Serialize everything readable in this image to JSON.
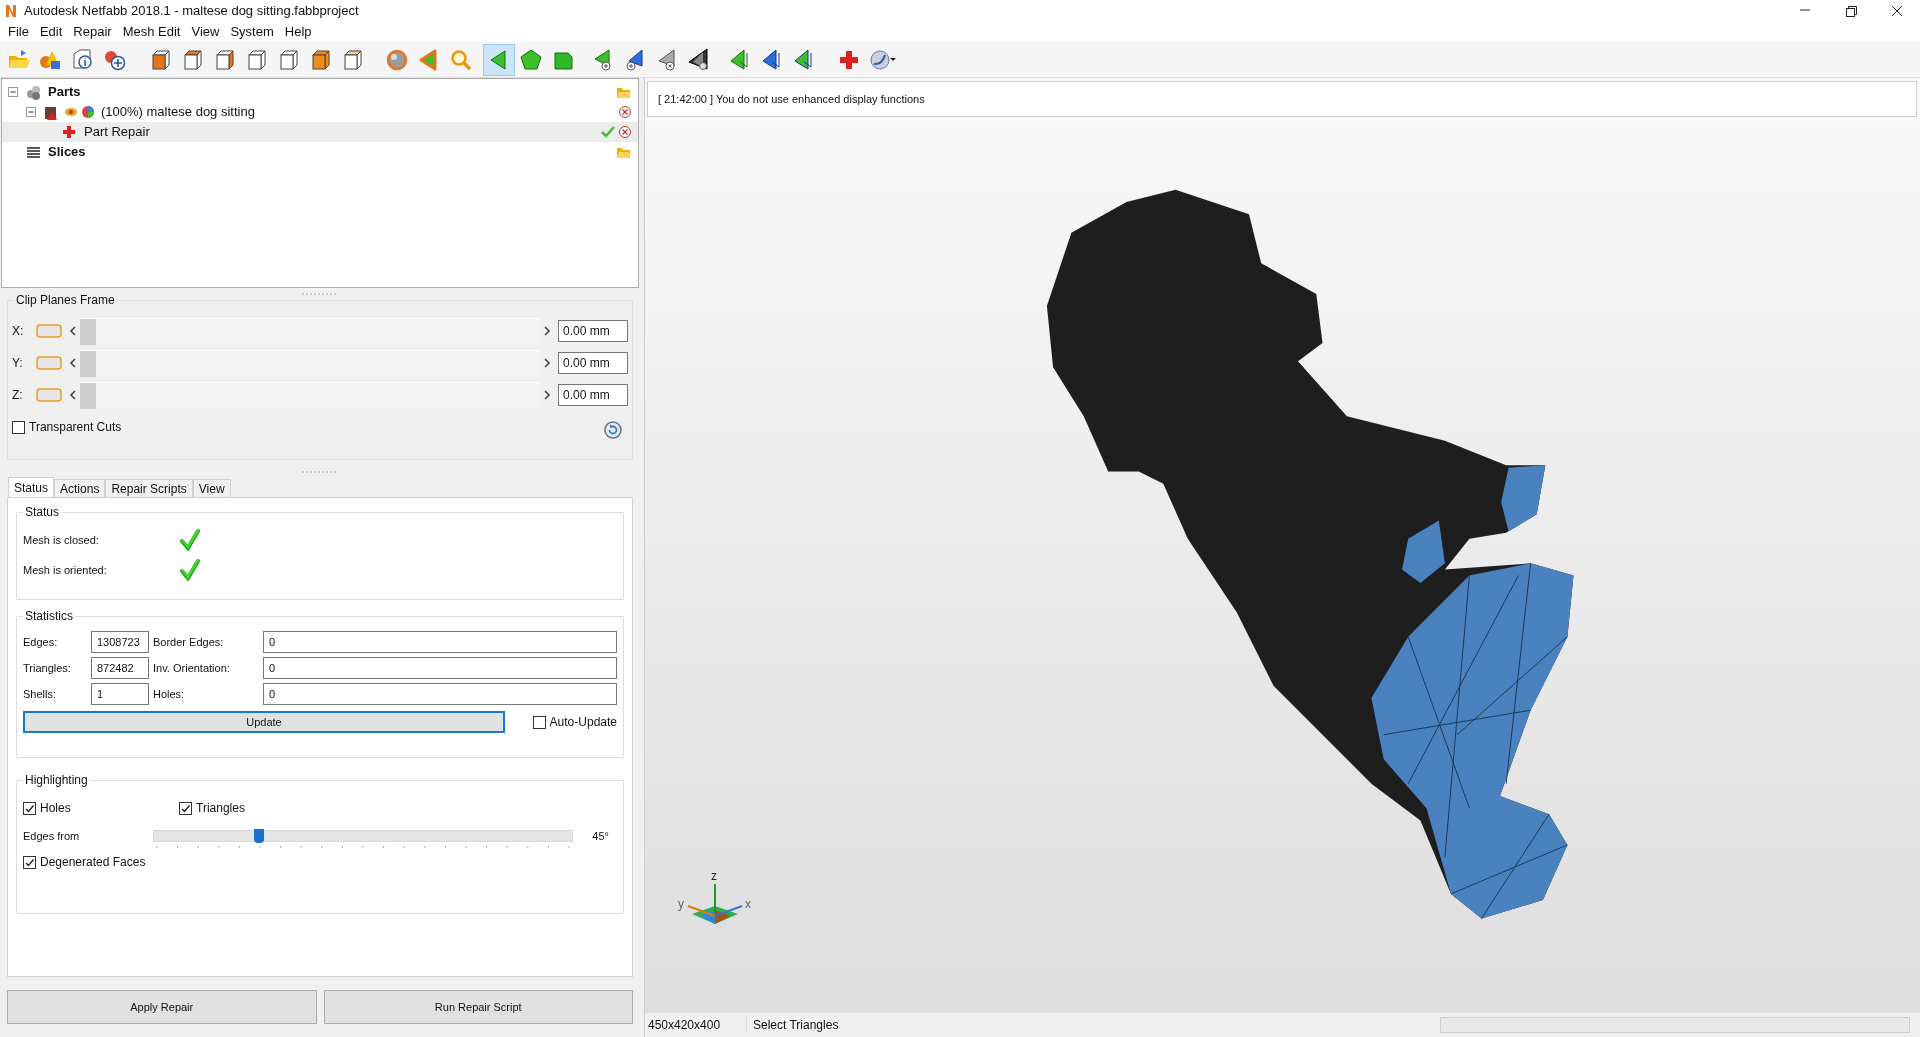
{
  "window": {
    "title": "Autodesk Netfabb 2018.1 - maltese dog sitting.fabbproject"
  },
  "menu": [
    "File",
    "Edit",
    "Repair",
    "Mesh Edit",
    "View",
    "System",
    "Help"
  ],
  "toolbar": [
    {
      "selected": false
    },
    {
      "selected": false
    },
    {
      "selected": false
    },
    {
      "selected": false
    },
    {
      "selected": false
    },
    {
      "selected": false
    },
    {
      "selected": false
    },
    {
      "selected": false
    },
    {
      "selected": false
    },
    {
      "selected": false
    },
    {
      "selected": false
    },
    {
      "selected": false
    },
    {
      "selected": false
    },
    {
      "selected": false
    },
    {
      "selected": true
    },
    {
      "selected": false
    },
    {
      "selected": false
    },
    {
      "selected": false
    },
    {
      "selected": false
    },
    {
      "selected": false
    },
    {
      "selected": false
    },
    {
      "selected": false
    },
    {
      "selected": false
    },
    {
      "selected": false
    },
    {
      "selected": false
    },
    {
      "selected": false
    }
  ],
  "tree": [
    {
      "kind": "group",
      "label": "Parts",
      "expanded": true,
      "selected": false,
      "children": [
        {
          "kind": "part",
          "label": "(100%) maltese dog sitting",
          "expanded": true,
          "selected": false,
          "children": [
            {
              "kind": "repair",
              "label": "Part Repair",
              "selected": true
            }
          ]
        }
      ]
    },
    {
      "kind": "slices",
      "label": "Slices",
      "selected": false
    }
  ],
  "clip_planes": {
    "title": "Clip Planes Frame",
    "axes": [
      {
        "label": "X:",
        "level": 0,
        "value": "0.00 mm"
      },
      {
        "label": "Y:",
        "level": 0,
        "value": "0.00 mm"
      },
      {
        "label": "Z:",
        "level": 0,
        "value": "0.00 mm"
      }
    ],
    "transparent_cuts": {
      "label": "Transparent Cuts",
      "checked": false
    }
  },
  "tabs": [
    {
      "label": "Status",
      "selected": true
    },
    {
      "label": "Actions",
      "selected": false
    },
    {
      "label": "Repair Scripts",
      "selected": false
    },
    {
      "label": "View",
      "selected": false
    }
  ],
  "status": {
    "title": "Status",
    "items": [
      {
        "label": "Mesh is closed:",
        "ok": true
      },
      {
        "label": "Mesh is oriented:",
        "ok": true
      }
    ]
  },
  "statistics": {
    "title": "Statistics",
    "rows": [
      [
        {
          "label": "Edges:",
          "value": "1308723"
        },
        {
          "label": "Border Edges:",
          "value": "0"
        }
      ],
      [
        {
          "label": "Triangles:",
          "value": "872482"
        },
        {
          "label": "Inv. Orientation:",
          "value": "0"
        }
      ],
      [
        {
          "label": "Shells:",
          "value": "1"
        },
        {
          "label": "Holes:",
          "value": "0"
        }
      ]
    ],
    "update_button": "Update",
    "auto_update": {
      "label": "Auto-Update",
      "checked": false
    }
  },
  "highlighting": {
    "title": "Highlighting",
    "holes": {
      "label": "Holes",
      "checked": true
    },
    "triangles": {
      "label": "Triangles",
      "checked": true
    },
    "edges_from": {
      "label": "Edges from",
      "level": 0.25,
      "reading": "45°"
    },
    "degenerated_faces": {
      "label": "Degenerated Faces",
      "checked": true
    }
  },
  "buttons": [
    "Apply Repair",
    "Run Repair Script"
  ],
  "log": "[ 21:42:00 ] You do not use enhanced display functions",
  "axis_labels": {
    "z": "z",
    "y": "y",
    "x": "x"
  },
  "status_bar": [
    "450x420x400",
    "Select Triangles"
  ],
  "progress": {
    "level": 0
  }
}
